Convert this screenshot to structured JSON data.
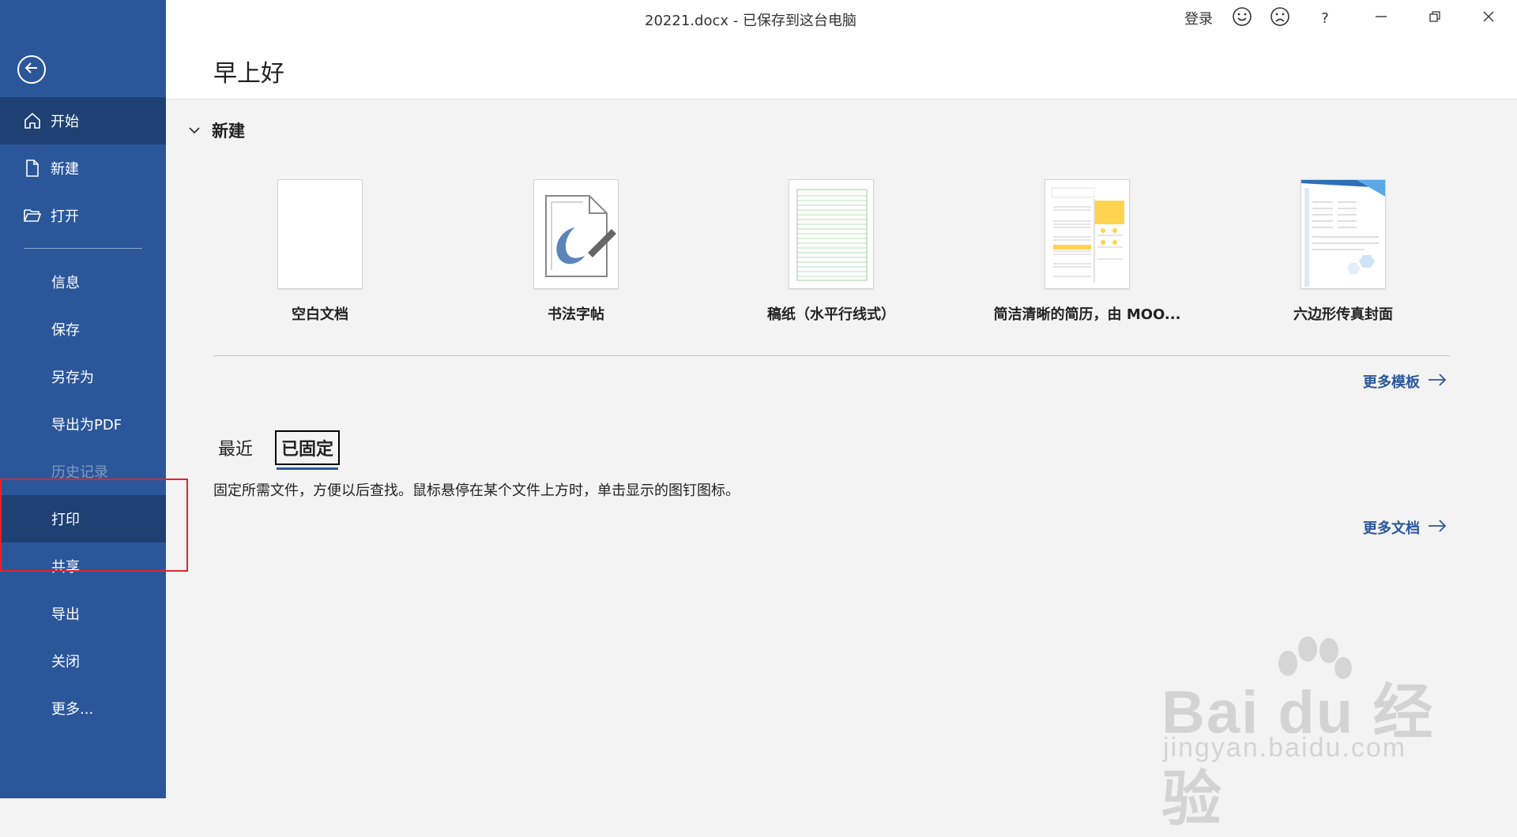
{
  "window": {
    "doc_title": "20221.docx  -  已保存到这台电脑",
    "login_label": "登录",
    "help_label": "?",
    "minimize_label": "—",
    "restore_label": "❐",
    "close_label": "✕"
  },
  "sidebar": {
    "items": [
      {
        "label": "开始",
        "icon": "home-icon"
      },
      {
        "label": "新建",
        "icon": "new-doc-icon"
      },
      {
        "label": "打开",
        "icon": "folder-open-icon"
      },
      {
        "label": "信息"
      },
      {
        "label": "保存"
      },
      {
        "label": "另存为"
      },
      {
        "label": "导出为PDF"
      },
      {
        "label": "历史记录"
      },
      {
        "label": "打印"
      },
      {
        "label": "共享"
      },
      {
        "label": "导出"
      },
      {
        "label": "关闭"
      },
      {
        "label": "更多..."
      }
    ]
  },
  "header": {
    "greeting": "早上好"
  },
  "new_section": {
    "title": "新建",
    "templates": [
      {
        "name": "空白文档"
      },
      {
        "name": "书法字帖"
      },
      {
        "name": "稿纸（水平行线式）"
      },
      {
        "name": "简洁清晰的简历，由 MOO..."
      },
      {
        "name": "六边形传真封面"
      }
    ],
    "more_templates": "更多模板"
  },
  "docs_section": {
    "tabs": [
      {
        "label": "最近"
      },
      {
        "label": "已固定",
        "active": true
      }
    ],
    "hint": "固定所需文件，方便以后查找。鼠标悬停在某个文件上方时，单击显示的图钉图标。",
    "more_docs": "更多文档"
  },
  "watermark": {
    "brand": "Bai du 经验",
    "url": "jingyan.baidu.com"
  }
}
